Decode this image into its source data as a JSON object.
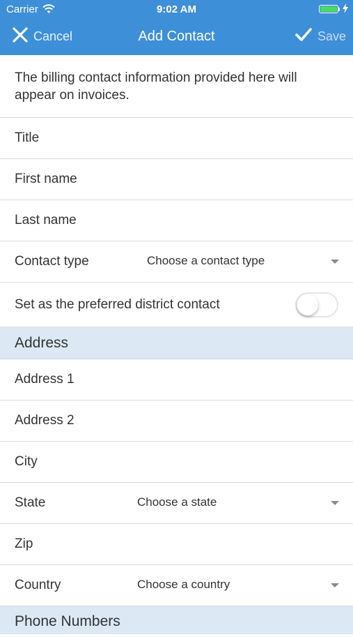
{
  "status_bar": {
    "carrier": "Carrier",
    "time": "9:02 AM",
    "wifi_icon": "wifi-icon",
    "battery_icon": "battery-icon",
    "battery_color": "#4cd964"
  },
  "nav": {
    "cancel_label": "Cancel",
    "title": "Add Contact",
    "save_label": "Save",
    "background_color": "#3d8fd8"
  },
  "intro_text": "The billing contact information provided here will appear on invoices.",
  "contact_fields": {
    "title": "Title",
    "first_name": "First name",
    "last_name": "Last name",
    "contact_type_label": "Contact type",
    "contact_type_value": "Choose a contact type",
    "preferred_label": "Set as the preferred district contact",
    "preferred_on": false
  },
  "address": {
    "section_title": "Address",
    "address1": "Address 1",
    "address2": "Address 2",
    "city": "City",
    "state_label": "State",
    "state_value": "Choose a state",
    "zip": "Zip",
    "country_label": "Country",
    "country_value": "Choose a country"
  },
  "phone": {
    "section_title": "Phone Numbers"
  },
  "section_color": "#dce8f4"
}
